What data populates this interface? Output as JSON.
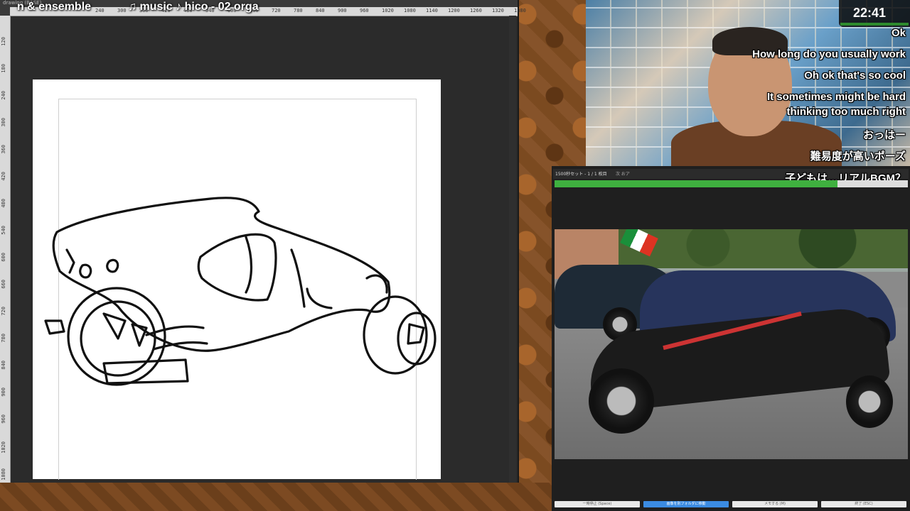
{
  "stream_overlay": {
    "title_left": "n & ensemble",
    "music_label": "♫ music ♪ hico - 02 orga",
    "clock": "22:41"
  },
  "canvas": {
    "tab_title": "drawing (BASE)",
    "ruler_top": [
      "240",
      "300",
      "360",
      "420",
      "480",
      "540",
      "600",
      "660",
      "720",
      "780",
      "840",
      "900",
      "960",
      "1020",
      "1080",
      "1140",
      "1200",
      "1260",
      "1320",
      "1380"
    ],
    "ruler_left": [
      "120",
      "180",
      "240",
      "300",
      "360",
      "420",
      "480",
      "540",
      "600",
      "660",
      "720",
      "780",
      "840",
      "900",
      "960",
      "1020",
      "1080"
    ]
  },
  "chat": {
    "messages": [
      "Ok",
      "How long do you usually work",
      "Oh ok that's so cool",
      "It sometimes might be hard",
      "thinking too much right",
      "おっはー",
      "難易度が高いポーズ",
      "子どもは…リアルBGM？"
    ]
  },
  "reference_panel": {
    "header": "1500秒セット - 1 / 1 枚目",
    "header_small": "次 おア",
    "progress": 0.8,
    "buttons": [
      "一時停止 (Space)",
      "画像を別フォルダに移動",
      "メモする (M)",
      "終了 (ESC)"
    ]
  },
  "colors": {
    "progress_fill": "#3fb03f",
    "primary_button": "#3b8be2",
    "canvas_bg": "#2b2b2b"
  }
}
